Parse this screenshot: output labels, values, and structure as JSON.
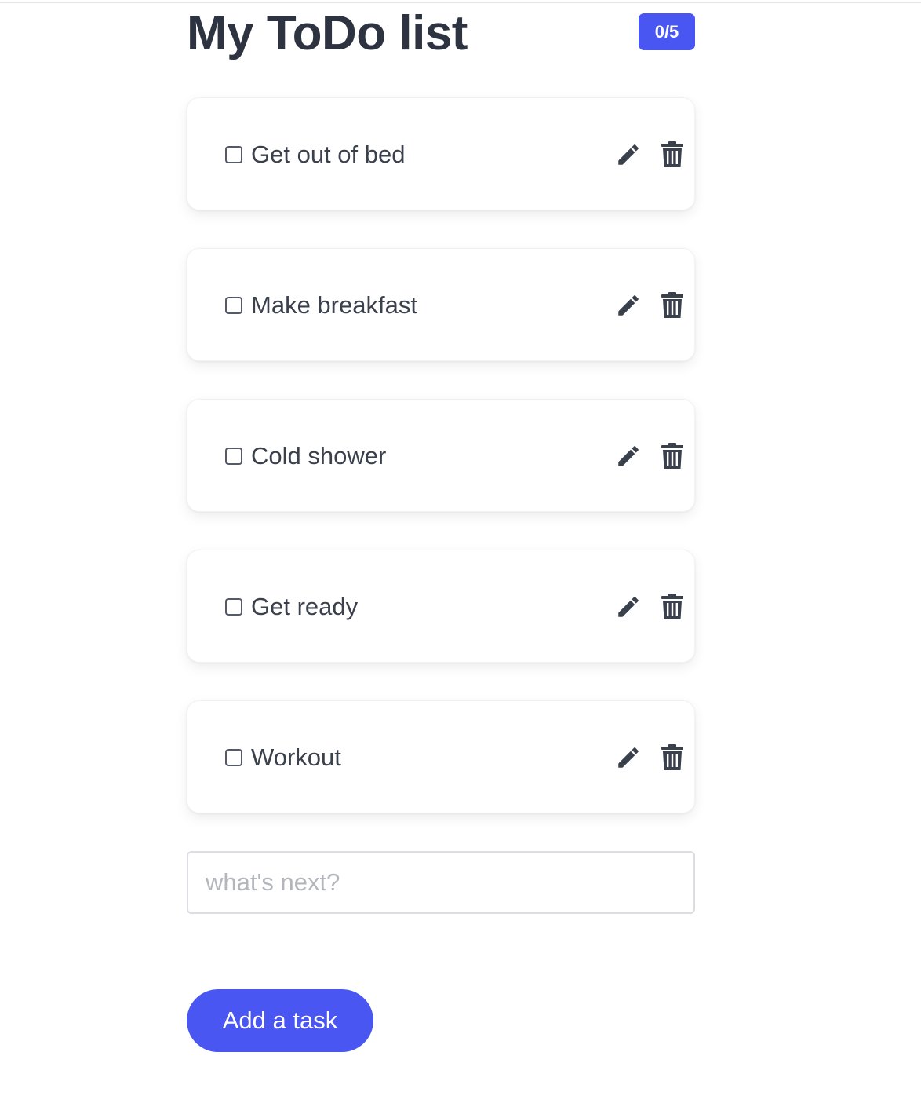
{
  "header": {
    "title": "My ToDo list",
    "badge": "0/5"
  },
  "tasks": [
    {
      "label": "Get out of bed",
      "checked": false
    },
    {
      "label": "Make breakfast",
      "checked": false
    },
    {
      "label": "Cold shower",
      "checked": false
    },
    {
      "label": "Get ready",
      "checked": false
    },
    {
      "label": "Workout",
      "checked": false
    }
  ],
  "icons": {
    "edit": "pencil-icon",
    "delete": "trash-icon"
  },
  "input": {
    "value": "",
    "placeholder": "what's next?"
  },
  "add_button": {
    "label": "Add a task"
  },
  "colors": {
    "accent": "#4a56f2",
    "text": "#2d3340",
    "icon": "#3a404c"
  }
}
